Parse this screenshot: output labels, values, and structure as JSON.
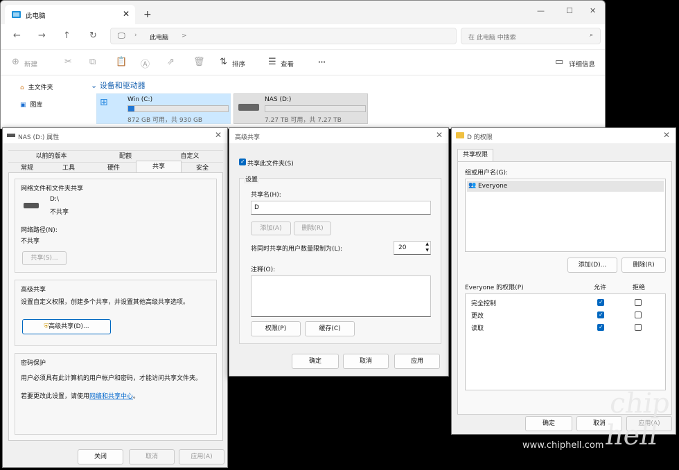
{
  "explorer": {
    "tab_title": "此电脑",
    "new_tab": "+",
    "close_tab": "✕",
    "window_controls": [
      "—",
      "☐",
      "✕"
    ],
    "breadcrumb": [
      "此电脑",
      ">"
    ],
    "search_placeholder": "在 此电脑 中搜索",
    "toolbar": {
      "new": "新建",
      "sort": "排序",
      "view": "查看",
      "more": "···",
      "details": "详细信息"
    },
    "nav": [
      {
        "label": "主文件夹"
      },
      {
        "label": "图库"
      }
    ],
    "section": "设备和驱动器",
    "drives": [
      {
        "name": "Win (C:)",
        "free": "872 GB 可用，共 930 GB",
        "used_fraction": 0.06
      },
      {
        "name": "NAS (D:)",
        "free": "7.27 TB 可用，共 7.27 TB",
        "used_fraction": 0.0
      }
    ]
  },
  "props": {
    "title": "NAS (D:) 属性",
    "tabs_top": [
      "以前的版本",
      "配额",
      "自定义"
    ],
    "tabs_bottom": [
      "常规",
      "工具",
      "硬件",
      "共享",
      "安全"
    ],
    "active_tab": "共享",
    "grp1_title": "网络文件和文件夹共享",
    "drive_path": "D:\\",
    "drive_status": "不共享",
    "net_path_label": "网络路径(N):",
    "net_path_value": "不共享",
    "share_btn": "共享(S)...",
    "grp2_title": "高级共享",
    "grp2_desc": "设置自定义权限，创建多个共享，并设置其他高级共享选项。",
    "adv_btn": "高级共享(D)...",
    "grp3_title": "密码保护",
    "grp3_desc": "用户必须具有此计算机的用户帐户和密码，才能访问共享文件夹。",
    "grp3_change": "若要更改此设置，请使用",
    "grp3_link": "网络和共享中心",
    "grp3_end": "。",
    "close": "关闭",
    "cancel": "取消",
    "apply": "应用(A)"
  },
  "adv": {
    "title": "高级共享",
    "share_check": "共享此文件夹(S)",
    "settings": "设置",
    "share_name_label": "共享名(H):",
    "share_name": "D",
    "add": "添加(A)",
    "remove": "删除(R)",
    "limit_label": "将同时共享的用户数量限制为(L):",
    "limit": "20",
    "comment_label": "注释(O):",
    "perm_btn": "权限(P)",
    "cache_btn": "缓存(C)",
    "ok": "确定",
    "cancel": "取消",
    "apply": "应用"
  },
  "perm": {
    "title": "D 的权限",
    "tab": "共享权限",
    "group_label": "组或用户名(G):",
    "user": "Everyone",
    "add": "添加(D)...",
    "remove": "删除(R)",
    "perm_label": "Everyone 的权限(P)",
    "allow": "允许",
    "deny": "拒绝",
    "rows": [
      {
        "name": "完全控制",
        "allow": true,
        "deny": false
      },
      {
        "name": "更改",
        "allow": true,
        "deny": false
      },
      {
        "name": "读取",
        "allow": true,
        "deny": false
      }
    ],
    "ok": "确定",
    "cancel": "取消",
    "apply": "应用(A)"
  },
  "watermark": {
    "logo": "chip hell",
    "url": "www.chiphell.com"
  }
}
